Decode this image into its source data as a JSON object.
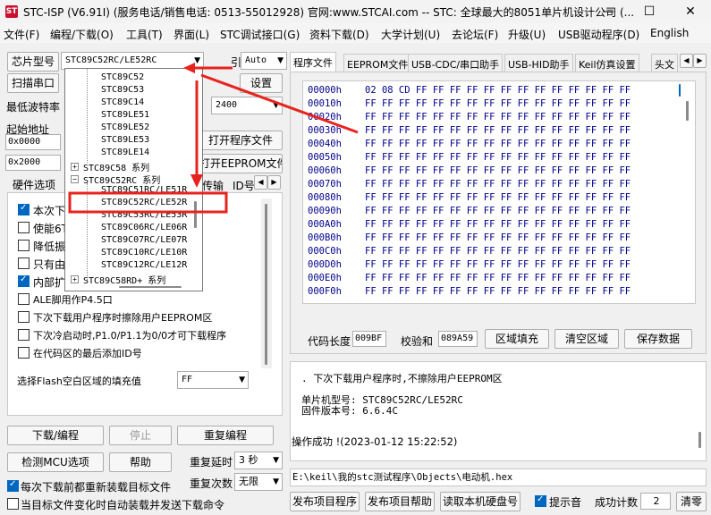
{
  "window": {
    "title": "STC-ISP (V6.91I) (服务电话/销售电话: 0513-55012928) 官网:www.STCAI.com  -- STC: 全球最大的8051单片机设计公司 (...",
    "icon_text": "ST",
    "minimize_glyph": "—",
    "maximize_glyph": "☐",
    "close_glyph": "✕"
  },
  "menu": [
    "文件(F)",
    "编程/下载(O)",
    "工具(T)",
    "界面(L)",
    "STC调试接口(G)",
    "资料下载(D)",
    "大学计划(U)",
    "去论坛(F)",
    "升级(U)",
    "USB驱动程序(D)",
    "English"
  ],
  "left": {
    "chip_label": "芯片型号",
    "chip_value": "STC89C52RC/LE52RC",
    "pin_label": "引脚数",
    "pin_value": "Auto",
    "scan_button": "扫描串口",
    "settings_button": "设置",
    "min_baud_label": "最低波特率",
    "baud_value": "2400",
    "start_addr_label": "起始地址",
    "addr1": "0x0000",
    "addr2": "0x2000",
    "open_program_button": "打开程序文件",
    "open_eeprom_button": "打开EEPROM文件",
    "hw_tab": "硬件选项",
    "transfer_tab_fragment": "传输",
    "id_tab_fragment": "ID号",
    "options": [
      {
        "label": "本次下",
        "checked": true
      },
      {
        "label": "使能6T",
        "checked": false
      },
      {
        "label": "降低振",
        "checked": false
      },
      {
        "label": "只有由",
        "checked": false
      },
      {
        "label": "内部扩",
        "checked": true
      },
      {
        "label": "ALE脚用作P4.5口",
        "checked": false
      },
      {
        "label": "下次下载用户程序时擦除用户EEPROM区",
        "checked": false
      },
      {
        "label": "下次冷启动时,P1.0/P1.1为0/0才可下载程序",
        "checked": false
      },
      {
        "label": "在代码区的最后添加ID号",
        "checked": false
      }
    ],
    "fill_label": "选择Flash空白区域的填充值",
    "fill_value": "FF",
    "download_button": "下载/编程",
    "stop_button": "停止",
    "reprogram_button": "重复编程",
    "detect_button": "检测MCU选项",
    "help_button": "帮助",
    "repeat_delay_label": "重复延时",
    "repeat_delay_value": "3 秒",
    "repeat_count_label": "重复次数",
    "repeat_count_value": "无限",
    "reload_label": "每次下载前都重新装载目标文件",
    "reload_checked": true,
    "auto_label": "当目标文件变化时自动装载并发送下载命令",
    "auto_checked": false
  },
  "dropdown": {
    "items": [
      "STC89C52",
      "STC89C53",
      "STC89C14",
      "STC89LE51",
      "STC89LE52",
      "STC89LE53",
      "STC89LE14"
    ],
    "group1": "STC89C58 系列",
    "group2": "STC89C52RC 系列",
    "sub_items": [
      "STC89C51RC/LE51R",
      "STC89C52RC/LE52R",
      "STC89C53RC/LE53R",
      "STC89C06RC/LE06R",
      "STC89C07RC/LE07R",
      "STC89C10RC/LE10R",
      "STC89C12RC/LE12R"
    ],
    "group3": "STC89C58RD+ 系列",
    "selected": "STC89C52RC/LE52R"
  },
  "right": {
    "tabs": [
      "程序文件",
      "EEPROM文件",
      "USB-CDC/串口助手",
      "USB-HID助手",
      "Keil仿真设置",
      "头文"
    ],
    "hex_addresses": [
      "00000h",
      "00010h",
      "00020h",
      "00030h",
      "00040h",
      "00050h",
      "00060h",
      "00070h",
      "00080h",
      "00090h",
      "000A0h",
      "000B0h",
      "000C0h",
      "000D0h",
      "000E0h",
      "000F0h"
    ],
    "hex_rows": [
      "02 08 CD FF FF FF FF FF FF FF FF FF FF FF FF FF",
      "FF FF FF FF FF FF FF FF FF FF FF FF FF FF FF FF",
      "FF FF FF FF FF FF FF FF FF FF FF FF FF FF FF FF",
      "FF FF FF FF FF FF FF FF FF FF FF FF FF FF FF FF",
      "FF FF FF FF FF FF FF FF FF FF FF FF FF FF FF FF",
      "FF FF FF FF FF FF FF FF FF FF FF FF FF FF FF FF",
      "FF FF FF FF FF FF FF FF FF FF FF FF FF FF FF FF",
      "FF FF FF FF FF FF FF FF FF FF FF FF FF FF FF FF",
      "FF FF FF FF FF FF FF FF FF FF FF FF FF FF FF FF",
      "FF FF FF FF FF FF FF FF FF FF FF FF FF FF FF FF",
      "FF FF FF FF FF FF FF FF FF FF FF FF FF FF FF FF",
      "FF FF FF FF FF FF FF FF FF FF FF FF FF FF FF FF",
      "FF FF FF FF FF FF FF FF FF FF FF FF FF FF FF FF",
      "FF FF FF FF FF FF FF FF FF FF FF FF FF FF FF FF",
      "FF FF FF FF FF FF FF FF FF FF FF FF FF FF FF FF",
      "FF FF FF FF FF FF FF FF FF FF FF FF FF FF FF FF"
    ],
    "code_len_label": "代码长度",
    "code_len_value": "009BF",
    "checksum_label": "校验和",
    "checksum_value": "089A59",
    "fill_region_button": "区域填充",
    "clear_region_button": "清空区域",
    "save_data_button": "保存数据",
    "log_lines": [
      ". 下次下载用户程序时,不擦除用户EEPROM区",
      "单片机型号: STC89C52RC/LE52RC",
      "固件版本号: 6.6.4C",
      "操作成功 !(2023-01-12 15:22:52)"
    ],
    "file_path": "E:\\keil\\我的stc测试程序\\Objects\\电动机.hex",
    "publish_project_button": "发布项目程序",
    "publish_help_button": "发布项目帮助",
    "read_disk_button": "读取本机硬盘号",
    "beep_label": "提示音",
    "beep_checked": true,
    "success_count_label": "成功计数",
    "success_count_value": "2",
    "clear_button": "清零"
  },
  "colors": {
    "annotation_red": "#e8231e",
    "hex_text": "#00008b",
    "accent_blue": "#0067c0"
  }
}
